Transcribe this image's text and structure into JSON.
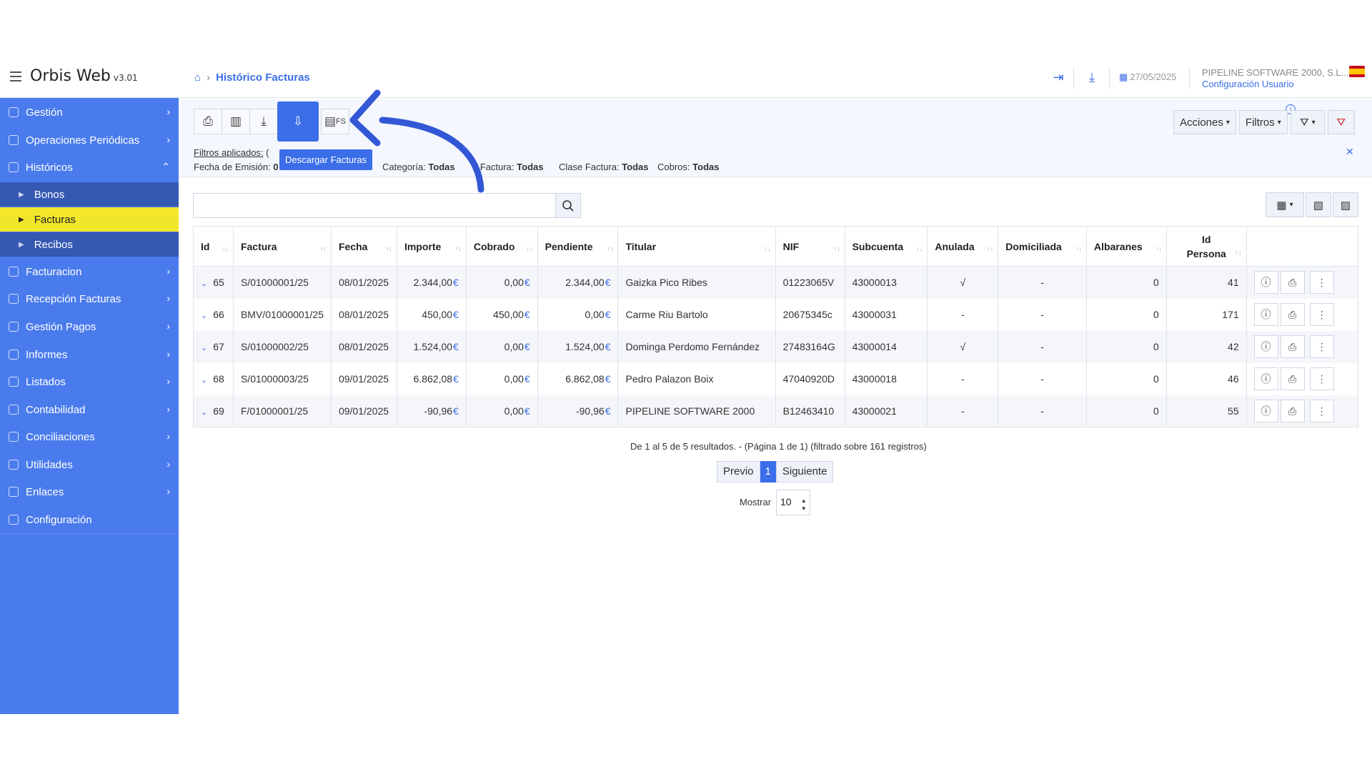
{
  "app": {
    "title": "Orbis Web",
    "version": "v3.01"
  },
  "breadcrumb": {
    "current": "Histórico Facturas"
  },
  "header": {
    "date": "27/05/2025",
    "company": "PIPELINE SOFTWARE 2000, S.L...",
    "config_user": "Configuración Usuario",
    "icons": [
      "login-icon",
      "download-icon",
      "calendar-icon",
      "flag-spain-icon"
    ]
  },
  "sidebar": {
    "items": [
      {
        "label": "Gestión"
      },
      {
        "label": "Operaciones Periódicas"
      },
      {
        "label": "Históricos"
      },
      {
        "label": "Facturacion"
      },
      {
        "label": "Recepción Facturas"
      },
      {
        "label": "Gestión Pagos"
      },
      {
        "label": "Informes"
      },
      {
        "label": "Listados"
      },
      {
        "label": "Contabilidad"
      },
      {
        "label": "Conciliaciones"
      },
      {
        "label": "Utilidades"
      },
      {
        "label": "Enlaces"
      },
      {
        "label": "Configuración"
      }
    ],
    "sub": [
      {
        "label": "Bonos"
      },
      {
        "label": "Facturas"
      },
      {
        "label": "Recibos"
      }
    ]
  },
  "toolbar": {
    "tooltip": "Descargar Facturas",
    "fs_label": "FS",
    "acciones": "Acciones",
    "filtros": "Filtros"
  },
  "filters": {
    "applied_label": "Filtros aplicados:",
    "applied_paren": "(",
    "fecha_label": "Fecha de Emisión:",
    "fecha_value": "0",
    "categoria_label": "Categoría:",
    "categoria_value": "Todas",
    "tipo_label": "o Factura:",
    "tipo_value": "Todas",
    "clase_label": "Clase Factura:",
    "clase_value": "Todas",
    "cobros_label": "Cobros:",
    "cobros_value": "Todas"
  },
  "search": {
    "placeholder": ""
  },
  "table": {
    "headers": [
      "Id",
      "Factura",
      "Fecha",
      "Importe",
      "Cobrado",
      "Pendiente",
      "Titular",
      "NIF",
      "Subcuenta",
      "Anulada",
      "Domiciliada",
      "Albaranes",
      "Id Persona"
    ],
    "currency": "€",
    "rows": [
      {
        "id": "65",
        "factura": "S/01000001/25",
        "fecha": "08/01/2025",
        "importe": "2.344,00",
        "cobrado": "0,00",
        "pendiente": "2.344,00",
        "titular": "Gaizka Pico Ribes",
        "nif": "01223065V",
        "subcuenta": "43000013",
        "anulada": "√",
        "domiciliada": "-",
        "albaranes": "0",
        "persona": "41"
      },
      {
        "id": "66",
        "factura": "BMV/01000001/25",
        "fecha": "08/01/2025",
        "importe": "450,00",
        "cobrado": "450,00",
        "pendiente": "0,00",
        "titular": "Carme Riu Bartolo",
        "nif": "20675345c",
        "subcuenta": "43000031",
        "anulada": "-",
        "domiciliada": "-",
        "albaranes": "0",
        "persona": "171"
      },
      {
        "id": "67",
        "factura": "S/01000002/25",
        "fecha": "08/01/2025",
        "importe": "1.524,00",
        "cobrado": "0,00",
        "pendiente": "1.524,00",
        "titular": "Dominga Perdomo Fernández",
        "nif": "27483164G",
        "subcuenta": "43000014",
        "anulada": "√",
        "domiciliada": "-",
        "albaranes": "0",
        "persona": "42"
      },
      {
        "id": "68",
        "factura": "S/01000003/25",
        "fecha": "09/01/2025",
        "importe": "6.862,08",
        "cobrado": "0,00",
        "pendiente": "6.862,08",
        "titular": "Pedro Palazon Boix",
        "nif": "47040920D",
        "subcuenta": "43000018",
        "anulada": "-",
        "domiciliada": "-",
        "albaranes": "0",
        "persona": "46"
      },
      {
        "id": "69",
        "factura": "F/01000001/25",
        "fecha": "09/01/2025",
        "importe": "-90,96",
        "cobrado": "0,00",
        "pendiente": "-90,96",
        "titular": "PIPELINE SOFTWARE 2000",
        "nif": "B12463410",
        "subcuenta": "43000021",
        "anulada": "-",
        "domiciliada": "-",
        "albaranes": "0",
        "persona": "55"
      }
    ]
  },
  "pagination": {
    "info": "De 1 al 5 de 5 resultados. - (Página 1 de 1) (filtrado sobre 161 registros)",
    "prev": "Previo",
    "current": "1",
    "next": "Siguiente",
    "show_label": "Mostrar",
    "show_value": "10"
  },
  "colors": {
    "accent": "#3b6ee8",
    "sidebar": "#4a7bec",
    "active_item": "#f2e62a",
    "annotation_arrow": "#3358d6"
  }
}
